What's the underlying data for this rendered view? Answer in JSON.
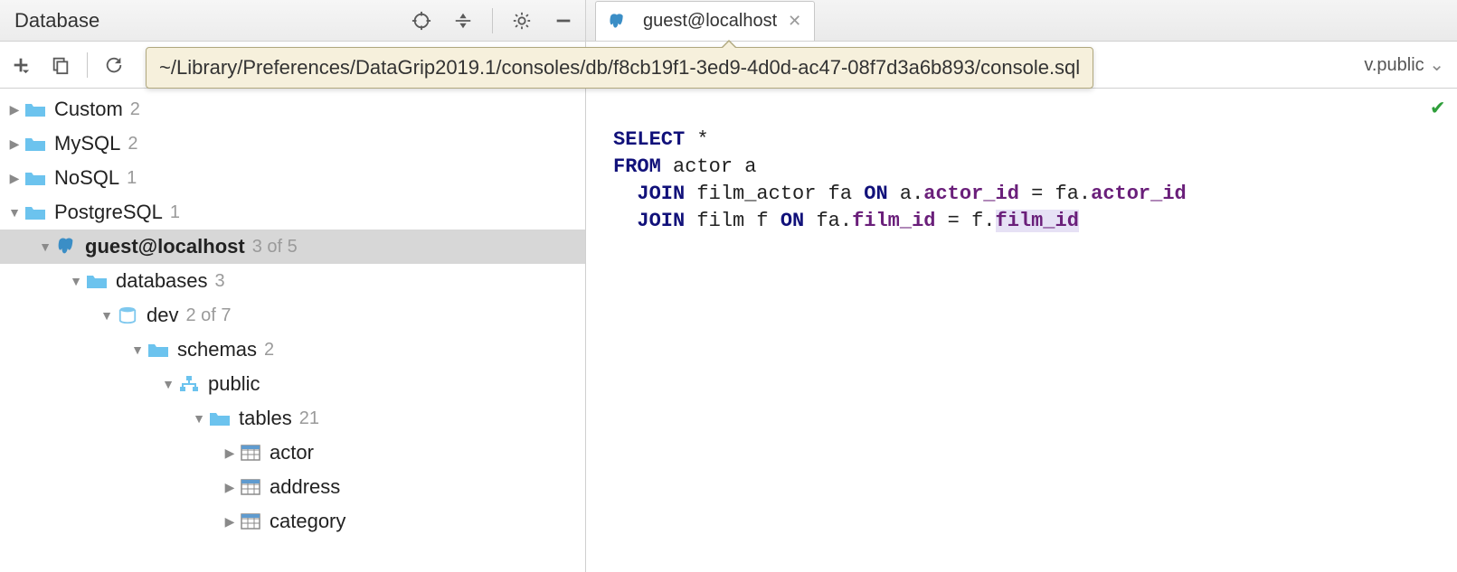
{
  "panel": {
    "title": "Database"
  },
  "tooltip": {
    "path": "~/Library/Preferences/DataGrip2019.1/consoles/db/f8cb19f1-3ed9-4d0d-ac47-08f7d3a6b893/console.sql"
  },
  "tree": {
    "custom": {
      "label": "Custom",
      "count": "2"
    },
    "mysql": {
      "label": "MySQL",
      "count": "2"
    },
    "nosql": {
      "label": "NoSQL",
      "count": "1"
    },
    "postgres": {
      "label": "PostgreSQL",
      "count": "1"
    },
    "conn": {
      "label": "guest@localhost",
      "count": "3 of 5"
    },
    "databases": {
      "label": "databases",
      "count": "3"
    },
    "dev": {
      "label": "dev",
      "count": "2 of 7"
    },
    "schemas": {
      "label": "schemas",
      "count": "2"
    },
    "public": {
      "label": "public"
    },
    "tables": {
      "label": "tables",
      "count": "21"
    },
    "actor": {
      "label": "actor"
    },
    "address": {
      "label": "address"
    },
    "category": {
      "label": "category"
    }
  },
  "tab": {
    "title": "guest@localhost"
  },
  "schema_selector": {
    "label": "v.public"
  },
  "sql": {
    "l1_kw": "SELECT",
    "l1_rest": " *",
    "l2_kw": "FROM",
    "l2_rest": " actor a",
    "l3_ind": "  ",
    "l3_kw1": "JOIN",
    "l3_m1": " film_actor fa ",
    "l3_kw2": "ON",
    "l3_m2": " a.",
    "l3_c1": "actor_id",
    "l3_m3": " = fa.",
    "l3_c2": "actor_id",
    "l4_ind": "  ",
    "l4_kw1": "JOIN",
    "l4_m1": " film f ",
    "l4_kw2": "ON",
    "l4_m2": " fa.",
    "l4_c1": "film_id",
    "l4_m3": " = f.",
    "l4_c2": "film_id"
  }
}
